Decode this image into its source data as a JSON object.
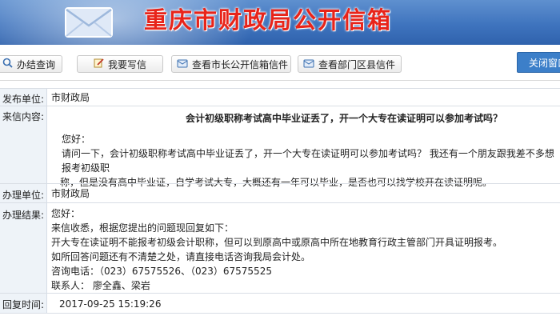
{
  "header": {
    "title": "重庆市财政局公开信箱",
    "brand_color": "#e8241a",
    "background": "#3f74be"
  },
  "toolbar": {
    "buttons": [
      {
        "label": "办结查询",
        "icon": "search-icon"
      },
      {
        "label": "我要写信",
        "icon": "write-icon"
      },
      {
        "label": "查看市长公开信箱信件",
        "icon": "inbox-icon"
      },
      {
        "label": "查看部门区县信件",
        "icon": "inbox-icon"
      }
    ],
    "close_label": "关闭窗口"
  },
  "letter": {
    "sender_label": "发布单位:",
    "sender_value": "市财政局",
    "content_label": "来信内容:",
    "subject": "会计初级职称考试高中毕业证丢了，开一个大专在读证明可以参加考试吗？",
    "greeting": "您好：",
    "body_line1": "请问一下，会计初级职称考试高中毕业证丢了，开一个大专在读证明可以参加考试吗？ 我还有一个朋友跟我差不多想报考初级职",
    "body_line2": "称，但是没有高中毕业证，自学考试大专，大概还有一年可以毕业，是否也可以找学校开在读证明呢。",
    "handler_label": "办理单位:",
    "handler_value": "市财政局",
    "result_label": "办理结果:",
    "result_lines": [
      "您好：",
      "来信收悉，根据您提出的问题现回复如下：",
      "开大专在读证明不能报考初级会计职称，但可以到原高中或原高中所在地教育行政主管部门开具证明报考。",
      "如所回答问题还有不清楚之处，请直接电话咨询我局会计处。",
      "咨询电话：（023）67575526、（023）67575525",
      "联系人：  廖全鑫、梁岩"
    ],
    "reply_time_label": "回复时间:",
    "reply_time_value": "2017-09-25 15:19:26"
  }
}
